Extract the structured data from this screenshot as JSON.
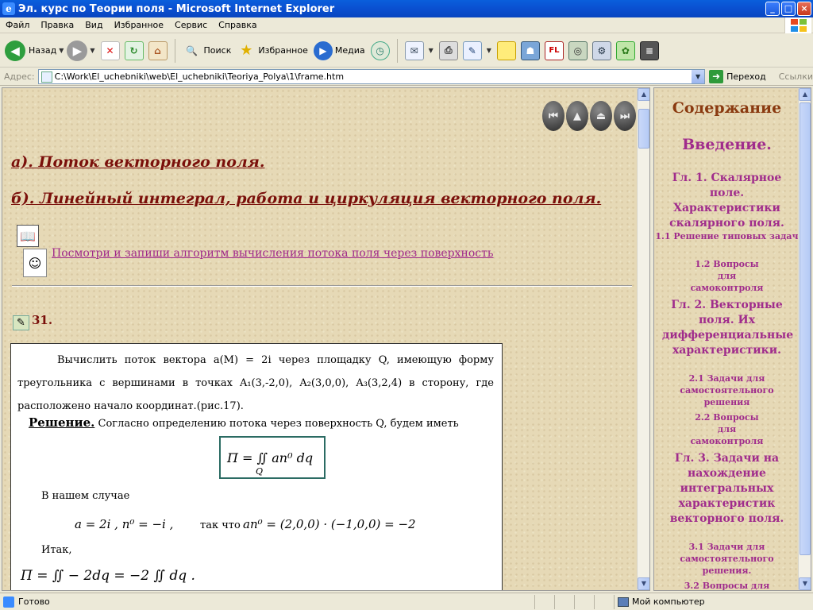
{
  "window": {
    "title": "Эл. курс по Теории поля - Microsoft Internet Explorer",
    "minimize": "_",
    "maximize": "□",
    "close": "×"
  },
  "menu": [
    "Файл",
    "Правка",
    "Вид",
    "Избранное",
    "Сервис",
    "Справка"
  ],
  "toolbar": {
    "back": "Назад",
    "search": "Поиск",
    "favorites": "Избранное",
    "media": "Медиа"
  },
  "address": {
    "label": "Адрес:",
    "url": "C:\\Work\\El_uchebniki\\web\\El_uchebniki\\Teoriya_Polya\\1\\frame.htm",
    "go": "Переход",
    "links": "Ссылки"
  },
  "content": {
    "heading_a": "а). Поток векторного поля.",
    "heading_b": "б). Линейный интеграл, работа и циркуляция векторного поля.",
    "algo_link": "Посмотри и запиши алгоритм вычисления потока поля через поверхность",
    "problem_number": "31.",
    "problem_text": "Вычислить поток вектора a(M) = 2i через площадку Q, имеющую форму треугольника с вершинами в точках A₁(3,-2,0), A₂(3,0,0), A₃(3,2,4) в сторону, где расположено начало координат.(рис.17).",
    "solution_label": "Решение.",
    "solution_text": "Согласно определению потока через поверхность Q, будем иметь",
    "formula_flux": "П = ∬ an⁰ dq",
    "formula_sub": "Q",
    "case_text": "В нашем случае",
    "formula_case": "a = 2i ,   n⁰ = −i ,",
    "so_that": "так что",
    "formula_product": "an⁰ = (2,0,0) · (−1,0,0) = −2",
    "itak": "Итак,",
    "formula_result": "П = ∬ − 2dq = −2 ∬ dq ."
  },
  "toc": [
    "Содержание",
    "Введение.",
    "Гл. 1. Скалярное поле. Характеристики скалярного поля.",
    "1.1 Решение типовых задач",
    "1.2 Вопросы для самоконтроля",
    "Гл. 2. Векторные поля. Их дифференциальные характеристики.",
    "2.1 Задачи для самостоятельного решения",
    "2.2 Вопросы для самоконтроля",
    "Гл. 3. Задачи на нахождение интегральных характеристик векторного поля.",
    "3.1 Задачи для самостоятельного решения.",
    "3.2 Вопросы для"
  ],
  "status": {
    "text": "Готово",
    "zone": "Мой компьютер"
  }
}
